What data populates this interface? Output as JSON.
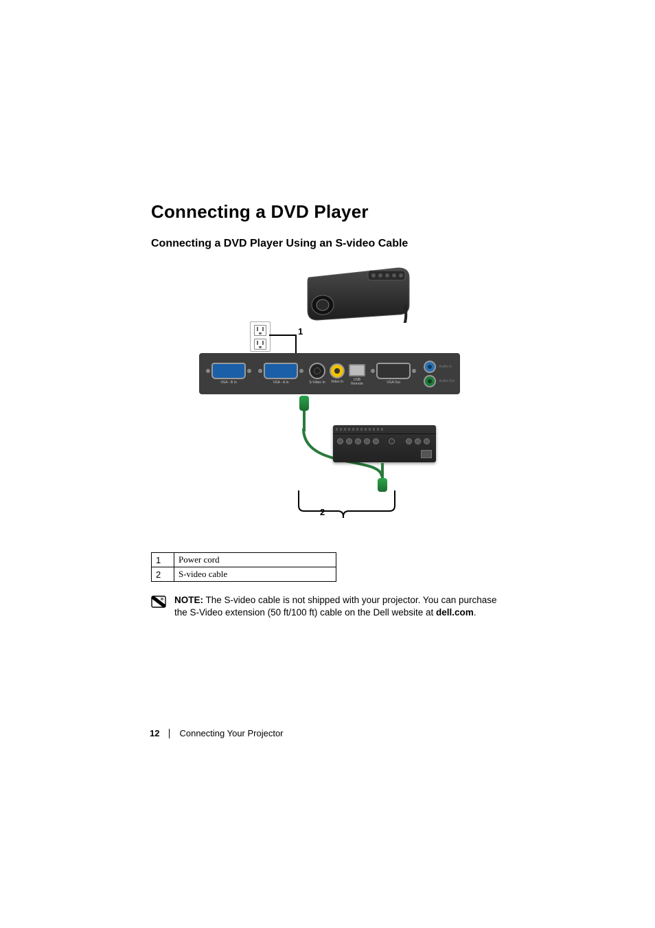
{
  "heading": "Connecting a DVD Player",
  "subheading": "Connecting a DVD Player Using an S-video Cable",
  "figure": {
    "callout1_number": "1",
    "callout2_number": "2",
    "panel_labels": {
      "vga_b": "VGA - B In",
      "vga_a": "VGA - A In",
      "svideo": "S-Video In",
      "video": "Video In",
      "usb": "USB\nRemote",
      "vga_out": "VGA Out",
      "audio_in": "Audio-In",
      "audio_out": "Audio-Out"
    }
  },
  "legend": [
    {
      "num": "1",
      "label": "Power cord"
    },
    {
      "num": "2",
      "label": "S-video cable"
    }
  ],
  "note": {
    "lead": "NOTE:",
    "body_before_site": " The S-video cable is not shipped with your projector. You can purchase the S-Video extension (50 ft/100 ft) cable on the Dell website at ",
    "site": "dell.com",
    "trailing": "."
  },
  "footer": {
    "page_number": "12",
    "section": "Connecting Your Projector"
  }
}
